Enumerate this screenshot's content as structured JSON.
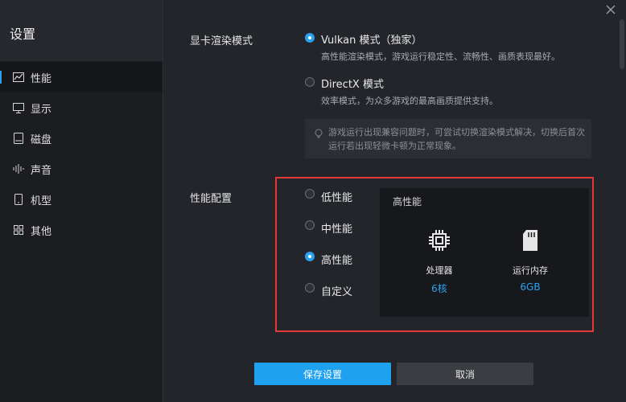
{
  "sidebar": {
    "title": "设置",
    "items": [
      {
        "label": "性能",
        "icon": "performance-chart-icon",
        "active": true
      },
      {
        "label": "显示",
        "icon": "monitor-icon",
        "active": false
      },
      {
        "label": "磁盘",
        "icon": "disk-icon",
        "active": false
      },
      {
        "label": "声音",
        "icon": "sound-wave-icon",
        "active": false
      },
      {
        "label": "机型",
        "icon": "phone-icon",
        "active": false
      },
      {
        "label": "其他",
        "icon": "grid-icon",
        "active": false
      }
    ]
  },
  "render_mode": {
    "label": "显卡渲染模式",
    "options": [
      {
        "label": "Vulkan 模式（独家）",
        "desc": "高性能渲染模式，游戏运行稳定性、流畅性、画质表现最好。",
        "checked": true
      },
      {
        "label": "DirectX 模式",
        "desc": "效率模式，为众多游戏的最高画质提供支持。",
        "checked": false
      }
    ],
    "tip": "游戏运行出现兼容问题时，可尝试切换渲染模式解决，切换后首次运行若出现轻微卡顿为正常现象。"
  },
  "perf_config": {
    "label": "性能配置",
    "options": [
      {
        "label": "低性能",
        "checked": false
      },
      {
        "label": "中性能",
        "checked": false
      },
      {
        "label": "高性能",
        "checked": true
      },
      {
        "label": "自定义",
        "checked": false
      }
    ],
    "panel": {
      "title": "高性能",
      "cpu": {
        "name": "处理器",
        "value": "6核",
        "icon": "cpu-chip-icon"
      },
      "ram": {
        "name": "运行内存",
        "value": "6GB",
        "icon": "memory-card-icon"
      }
    }
  },
  "buttons": {
    "save": "保存设置",
    "cancel": "取消"
  },
  "colors": {
    "accent": "#2aa1ef",
    "highlight_frame": "#e23a3a",
    "background": "#23252a"
  }
}
